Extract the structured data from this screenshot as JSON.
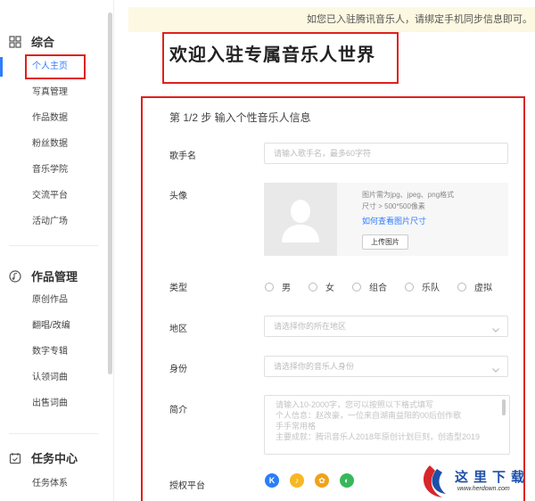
{
  "notice": {
    "text": "如您已入驻腾讯音乐人，请绑定手机同步信息即可。"
  },
  "sidebar": {
    "sections": [
      {
        "title": "综合",
        "icon": "grid-icon",
        "items": [
          "个人主页",
          "写真管理",
          "作品数据",
          "粉丝数据",
          "音乐学院",
          "交流平台",
          "活动广场"
        ]
      },
      {
        "title": "作品管理",
        "icon": "music-note-icon",
        "items": [
          "原创作品",
          "翻唱/改编",
          "数字专辑",
          "认领词曲",
          "出售词曲"
        ]
      },
      {
        "title": "任务中心",
        "icon": "calendar-check-icon",
        "items": [
          "任务体系"
        ]
      }
    ],
    "active_item": "个人主页"
  },
  "welcome": {
    "title": "欢迎入驻专属音乐人世界"
  },
  "form": {
    "step_title": "第 1/2 步 输入个性音乐人信息",
    "singer_name": {
      "label": "歌手名",
      "placeholder": "请输入歌手名，最多60字符"
    },
    "avatar": {
      "label": "头像",
      "hint1": "图片需为jpg、jpeg、png格式",
      "hint2": "尺寸 > 500*500像素",
      "link": "如何查看图片尺寸",
      "upload_label": "上传图片"
    },
    "type": {
      "label": "类型",
      "options": [
        "男",
        "女",
        "组合",
        "乐队",
        "虚拟"
      ]
    },
    "region": {
      "label": "地区",
      "placeholder": "请选择你的所在地区"
    },
    "identity": {
      "label": "身份",
      "placeholder": "请选择你的音乐人身份"
    },
    "bio": {
      "label": "简介",
      "lines": [
        "请输入10-2000字，您可以按照以下格式填写",
        "个人信息：赵改豪，一位来自湖南益阳的00后创作歌",
        "手手常用格",
        "主要成就：腾讯音乐人2018年原创计划巨刻，创造型2019"
      ]
    },
    "platforms": {
      "label": "授权平台",
      "items": [
        {
          "name": "kugou-icon",
          "glyph": "K",
          "color": "#2a7ef7"
        },
        {
          "name": "qq-music-icon",
          "glyph": "♪",
          "color": "#f6b722"
        },
        {
          "name": "kuwo-icon",
          "glyph": "✿",
          "color": "#f0a21a"
        },
        {
          "name": "quanmin-icon",
          "glyph": "◐",
          "color": "#36b85a"
        }
      ]
    }
  },
  "watermark": {
    "text": "这里下载",
    "url": "www.herdown.com"
  }
}
